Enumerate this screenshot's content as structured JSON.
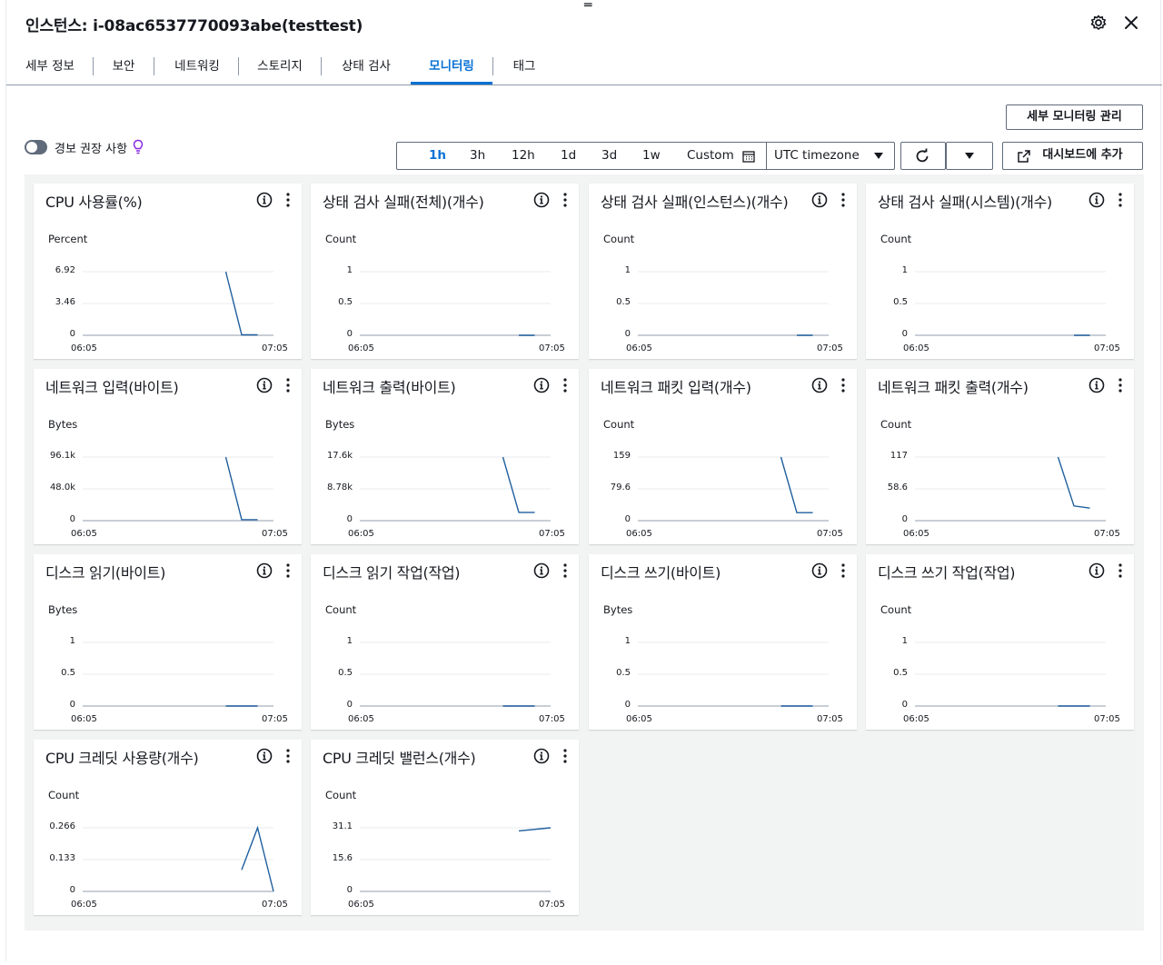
{
  "header": {
    "title": "인스턴스: i-08ac6537770093abe(testtest)"
  },
  "tabs": [
    {
      "label": "세부 정보"
    },
    {
      "label": "보안"
    },
    {
      "label": "네트워킹"
    },
    {
      "label": "스토리지"
    },
    {
      "label": "상태 검사"
    },
    {
      "label": "모니터링",
      "active": true
    },
    {
      "label": "태그"
    }
  ],
  "toolbar": {
    "manage_detailed_monitoring": "세부 모니터링 관리",
    "alarm_toggle_label": "경보 권장 사항",
    "time_ranges": [
      "1h",
      "3h",
      "12h",
      "1d",
      "3d",
      "1w"
    ],
    "custom_label": "Custom",
    "timezone": "UTC timezone",
    "add_to_dashboard": "대시보드에 추가"
  },
  "colors": {
    "accent": "#0972d3",
    "line": "#1f5f9e",
    "border": "#5f6b7a",
    "grid_bg": "#f2f3f3"
  },
  "chart_data": [
    {
      "type": "line",
      "title": "CPU 사용률(%)",
      "ylabel": "Percent",
      "yticks": [
        "6.92",
        "3.46",
        "0"
      ],
      "ylim": [
        0,
        6.92
      ],
      "x_range": [
        "06:05",
        "07:05"
      ],
      "x": [
        "06:50",
        "06:55",
        "07:00"
      ],
      "values": [
        6.92,
        0.05,
        0.05
      ]
    },
    {
      "type": "line",
      "title": "상태 검사 실패(전체)(개수)",
      "ylabel": "Count",
      "yticks": [
        "1",
        "0.5",
        "0"
      ],
      "ylim": [
        0,
        1
      ],
      "x_range": [
        "06:05",
        "07:05"
      ],
      "x": [
        "06:55",
        "07:00"
      ],
      "values": [
        0,
        0
      ]
    },
    {
      "type": "line",
      "title": "상태 검사 실패(인스턴스)(개수)",
      "ylabel": "Count",
      "yticks": [
        "1",
        "0.5",
        "0"
      ],
      "ylim": [
        0,
        1
      ],
      "x_range": [
        "06:05",
        "07:05"
      ],
      "x": [
        "06:55",
        "07:00"
      ],
      "values": [
        0,
        0
      ]
    },
    {
      "type": "line",
      "title": "상태 검사 실패(시스템)(개수)",
      "ylabel": "Count",
      "yticks": [
        "1",
        "0.5",
        "0"
      ],
      "ylim": [
        0,
        1
      ],
      "x_range": [
        "06:05",
        "07:05"
      ],
      "x": [
        "06:55",
        "07:00"
      ],
      "values": [
        0,
        0
      ]
    },
    {
      "type": "line",
      "title": "네트워크 입력(바이트)",
      "ylabel": "Bytes",
      "yticks": [
        "96.1k",
        "48.0k",
        "0"
      ],
      "ylim": [
        0,
        96100
      ],
      "x_range": [
        "06:05",
        "07:05"
      ],
      "x": [
        "06:50",
        "06:55",
        "07:00"
      ],
      "values": [
        96100,
        1500,
        1500
      ]
    },
    {
      "type": "line",
      "title": "네트워크 출력(바이트)",
      "ylabel": "Bytes",
      "yticks": [
        "17.6k",
        "8.78k",
        "0"
      ],
      "ylim": [
        0,
        17600
      ],
      "x_range": [
        "06:05",
        "07:05"
      ],
      "x": [
        "06:50",
        "06:55",
        "07:00"
      ],
      "values": [
        17600,
        2300,
        2300
      ]
    },
    {
      "type": "line",
      "title": "네트워크 패킷 입력(개수)",
      "ylabel": "Count",
      "yticks": [
        "159",
        "79.6",
        "0"
      ],
      "ylim": [
        0,
        159
      ],
      "x_range": [
        "06:05",
        "07:05"
      ],
      "x": [
        "06:50",
        "06:55",
        "07:00"
      ],
      "values": [
        159,
        20,
        20
      ]
    },
    {
      "type": "line",
      "title": "네트워크 패킷 출력(개수)",
      "ylabel": "Count",
      "yticks": [
        "117",
        "58.6",
        "0"
      ],
      "ylim": [
        0,
        117
      ],
      "x_range": [
        "06:05",
        "07:05"
      ],
      "x": [
        "06:50",
        "06:55",
        "07:00"
      ],
      "values": [
        117,
        27,
        23
      ]
    },
    {
      "type": "line",
      "title": "디스크 읽기(바이트)",
      "ylabel": "Bytes",
      "yticks": [
        "1",
        "0.5",
        "0"
      ],
      "ylim": [
        0,
        1
      ],
      "x_range": [
        "06:05",
        "07:05"
      ],
      "x": [
        "06:50",
        "07:00"
      ],
      "values": [
        0,
        0
      ]
    },
    {
      "type": "line",
      "title": "디스크 읽기 작업(작업)",
      "ylabel": "Count",
      "yticks": [
        "1",
        "0.5",
        "0"
      ],
      "ylim": [
        0,
        1
      ],
      "x_range": [
        "06:05",
        "07:05"
      ],
      "x": [
        "06:50",
        "07:00"
      ],
      "values": [
        0,
        0
      ]
    },
    {
      "type": "line",
      "title": "디스크 쓰기(바이트)",
      "ylabel": "Bytes",
      "yticks": [
        "1",
        "0.5",
        "0"
      ],
      "ylim": [
        0,
        1
      ],
      "x_range": [
        "06:05",
        "07:05"
      ],
      "x": [
        "06:50",
        "07:00"
      ],
      "values": [
        0,
        0
      ]
    },
    {
      "type": "line",
      "title": "디스크 쓰기 작업(작업)",
      "ylabel": "Count",
      "yticks": [
        "1",
        "0.5",
        "0"
      ],
      "ylim": [
        0,
        1
      ],
      "x_range": [
        "06:05",
        "07:05"
      ],
      "x": [
        "06:50",
        "07:00"
      ],
      "values": [
        0,
        0
      ]
    },
    {
      "type": "line",
      "title": "CPU 크레딧 사용량(개수)",
      "ylabel": "Count",
      "yticks": [
        "0.266",
        "0.133",
        "0"
      ],
      "ylim": [
        0,
        0.266
      ],
      "x_range": [
        "06:05",
        "07:05"
      ],
      "x": [
        "06:55",
        "07:00",
        "07:05"
      ],
      "values": [
        0.09,
        0.266,
        0.0
      ]
    },
    {
      "type": "line",
      "title": "CPU 크레딧 밸런스(개수)",
      "ylabel": "Count",
      "yticks": [
        "31.1",
        "15.6",
        "0"
      ],
      "ylim": [
        0,
        31.1
      ],
      "x_range": [
        "06:05",
        "07:05"
      ],
      "x": [
        "06:55",
        "07:05"
      ],
      "values": [
        29.6,
        31.1
      ]
    }
  ]
}
